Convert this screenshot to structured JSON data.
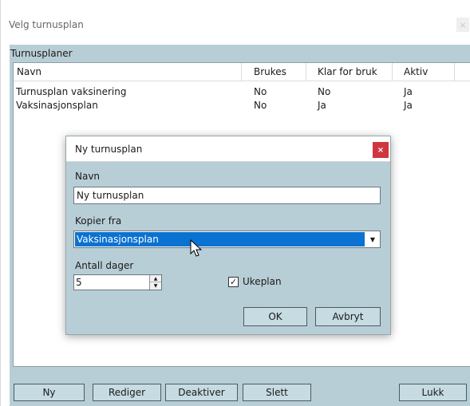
{
  "window": {
    "title": "Velg turnusplan",
    "close_glyph": "×"
  },
  "section": {
    "label": "Turnusplaner"
  },
  "table": {
    "columns": [
      "Navn",
      "Brukes",
      "Klar for bruk",
      "Aktiv"
    ],
    "rows": [
      [
        "Turnusplan vaksinering",
        "No",
        "No",
        "Ja"
      ],
      [
        "Vaksinasjonsplan",
        "No",
        "Ja",
        "Ja"
      ]
    ]
  },
  "buttons": {
    "new": "Ny",
    "edit": "Rediger",
    "deactivate": "Deaktiver",
    "delete": "Slett",
    "close": "Lukk"
  },
  "dialog": {
    "title": "Ny turnusplan",
    "close_glyph": "×",
    "name_label": "Navn",
    "name_value": "Ny turnusplan",
    "copy_label": "Kopier fra",
    "copy_value": "Vaksinasjonsplan",
    "days_label": "Antall dager",
    "days_value": "5",
    "weekplan_label": "Ukeplan",
    "weekplan_checked": true,
    "ok": "OK",
    "cancel": "Avbryt"
  },
  "colors": {
    "panel": "#b8ced6",
    "button": "#c6dbe2",
    "selection": "#0a72d1",
    "close_red": "#d0363f"
  },
  "icons": [
    "close-icon",
    "dropdown-arrow-icon",
    "spin-up-icon",
    "spin-down-icon",
    "checkmark-icon",
    "mouse-cursor-icon"
  ]
}
